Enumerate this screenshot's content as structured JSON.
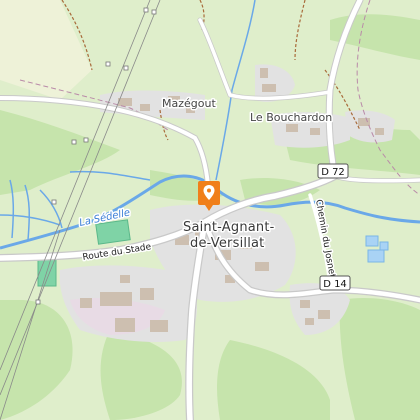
{
  "map": {
    "labels": {
      "village_mazegout": "Mazégout",
      "village_bouchardon": "Le Bouchardon",
      "town_line1": "Saint-Agnant-",
      "town_line2": "de-Versillat",
      "river": "La Sédelle",
      "road_stade": "Route du Stade",
      "road_chemin": "Chemin du Josnet"
    },
    "shields": {
      "d72": "D 72",
      "d14": "D 14"
    },
    "marker": {
      "icon": "map-pin-icon",
      "color": "#f07f1a"
    },
    "colors": {
      "land": "#dfeecb",
      "forest": "#c6e4ac",
      "residential": "#e2e2e2",
      "water": "#a9d3f5",
      "river": "#6aa8e8",
      "road": "#ffffff",
      "road_casing": "#c9c9c9",
      "track": "#a86a3a",
      "boundary": "#b98aa8",
      "powerline": "#8a8a8a",
      "pitch": "#7fd3a6"
    }
  }
}
